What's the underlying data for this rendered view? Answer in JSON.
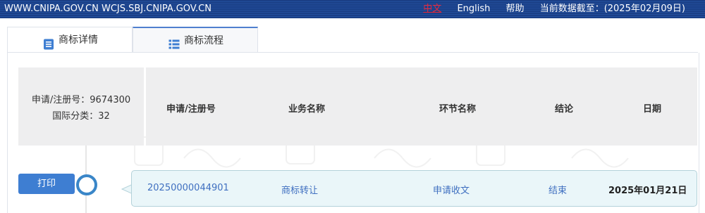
{
  "topbar": {
    "domains": "WWW.CNIPA.GOV.CN WCJS.SBJ.CNIPA.GOV.CN",
    "lang_cn": "中文",
    "lang_en": "English",
    "help": "帮助",
    "data_date": "当前数据截至：(2025年02月09日)"
  },
  "tabs": [
    {
      "label": "商标详情",
      "icon": "document-list-icon"
    },
    {
      "label": "商标流程",
      "icon": "list-icon"
    }
  ],
  "info": {
    "reg_no": "申请/注册号：9674300",
    "intl_class": "国际分类：32"
  },
  "table": {
    "columns": [
      "申请/注册号",
      "业务名称",
      "环节名称",
      "结论",
      "日期"
    ],
    "rows": [
      {
        "reg_no": "20250000044901",
        "business": "商标转让",
        "stage": "申请收文",
        "conclusion": "结束",
        "date": "2025年01月21日"
      }
    ]
  },
  "actions": {
    "print": "打印"
  },
  "colors": {
    "topbar_bg": "#1a3f86",
    "accent": "#3e7ed2",
    "link": "#3f6fc0",
    "lang_active": "#e8283a",
    "row_bg": "#eaf6f9"
  }
}
